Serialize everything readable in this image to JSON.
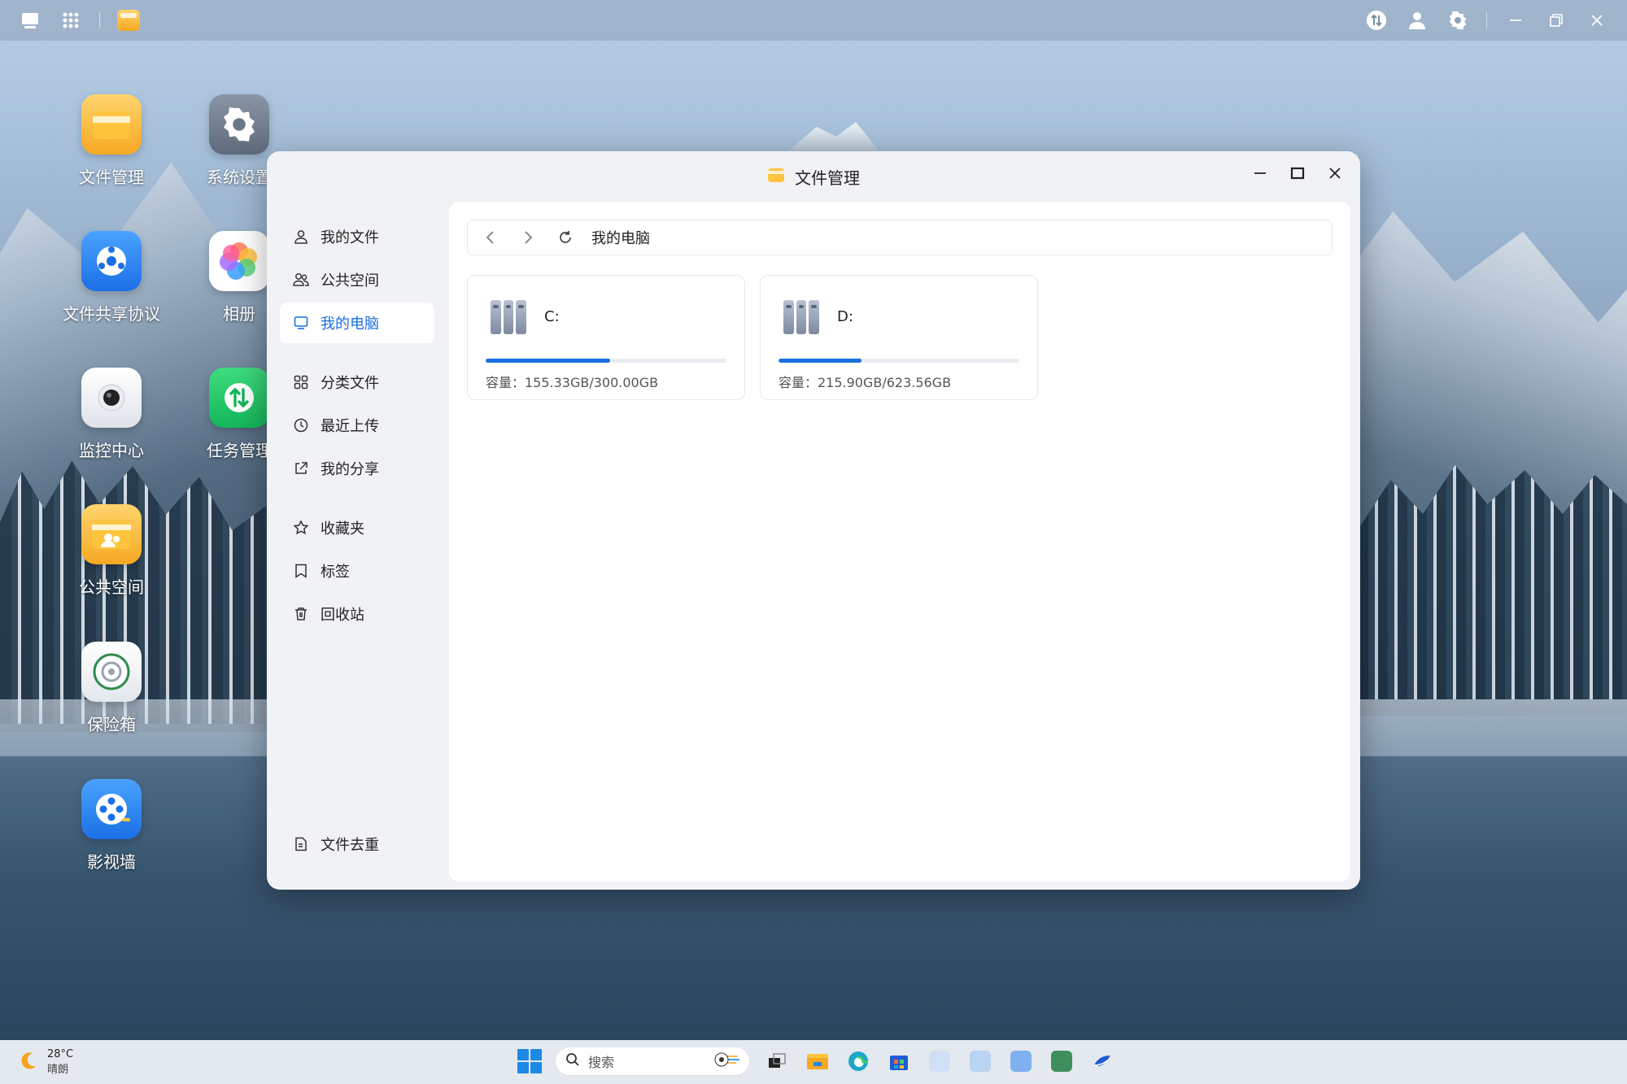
{
  "topbar": {
    "icons": [
      "show-desktop-icon",
      "app-grid-icon",
      "file-manager-icon",
      "download-task-icon",
      "user-icon",
      "settings-icon",
      "minimize-icon",
      "restore-icon",
      "close-icon"
    ]
  },
  "desktop": {
    "icons": [
      {
        "label": "文件管理",
        "icon": "folder-icon"
      },
      {
        "label": "系统设置",
        "icon": "gear-icon"
      },
      {
        "label": "文件共享协议",
        "icon": "share-protocol-icon"
      },
      {
        "label": "相册",
        "icon": "photos-icon"
      },
      {
        "label": "监控中心",
        "icon": "camera-icon"
      },
      {
        "label": "任务管理",
        "icon": "task-manager-icon"
      },
      {
        "label": "公共空间",
        "icon": "public-folder-icon"
      },
      {
        "label": "保险箱",
        "icon": "safe-icon"
      },
      {
        "label": "影视墙",
        "icon": "video-wall-icon"
      }
    ]
  },
  "window": {
    "title": "文件管理",
    "sidebar": {
      "items": [
        {
          "label": "我的文件",
          "icon": "user-icon"
        },
        {
          "label": "公共空间",
          "icon": "group-icon"
        },
        {
          "label": "我的电脑",
          "icon": "computer-icon",
          "active": true
        },
        {
          "label": "分类文件",
          "icon": "category-icon"
        },
        {
          "label": "最近上传",
          "icon": "clock-icon"
        },
        {
          "label": "我的分享",
          "icon": "share-icon"
        },
        {
          "label": "收藏夹",
          "icon": "star-icon"
        },
        {
          "label": "标签",
          "icon": "tag-icon"
        },
        {
          "label": "回收站",
          "icon": "trash-icon"
        }
      ],
      "bottom": {
        "label": "文件去重",
        "icon": "dedupe-icon"
      }
    },
    "path": {
      "current": "我的电脑"
    },
    "drives": [
      {
        "name": "C:",
        "capacity": "容量：155.33GB/300.00GB",
        "used_fraction": 0.518
      },
      {
        "name": "D:",
        "capacity": "容量：215.90GB/623.56GB",
        "used_fraction": 0.346
      }
    ]
  },
  "taskbar": {
    "weather": {
      "temp": "28°C",
      "desc": "晴朗"
    },
    "search_placeholder": "搜索",
    "accent": "#1a6fe0"
  }
}
